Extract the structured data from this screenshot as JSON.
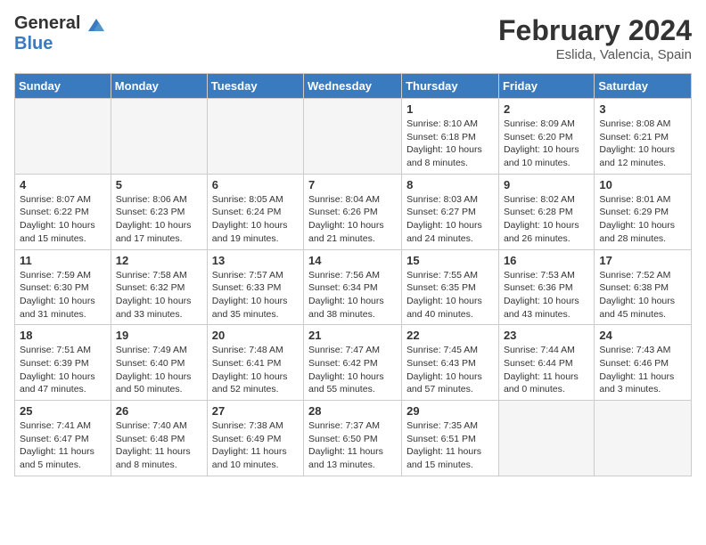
{
  "header": {
    "logo_general": "General",
    "logo_blue": "Blue",
    "title": "February 2024",
    "subtitle": "Eslida, Valencia, Spain"
  },
  "days_of_week": [
    "Sunday",
    "Monday",
    "Tuesday",
    "Wednesday",
    "Thursday",
    "Friday",
    "Saturday"
  ],
  "weeks": [
    [
      {
        "day": "",
        "info": ""
      },
      {
        "day": "",
        "info": ""
      },
      {
        "day": "",
        "info": ""
      },
      {
        "day": "",
        "info": ""
      },
      {
        "day": "1",
        "info": "Sunrise: 8:10 AM\nSunset: 6:18 PM\nDaylight: 10 hours and 8 minutes."
      },
      {
        "day": "2",
        "info": "Sunrise: 8:09 AM\nSunset: 6:20 PM\nDaylight: 10 hours and 10 minutes."
      },
      {
        "day": "3",
        "info": "Sunrise: 8:08 AM\nSunset: 6:21 PM\nDaylight: 10 hours and 12 minutes."
      }
    ],
    [
      {
        "day": "4",
        "info": "Sunrise: 8:07 AM\nSunset: 6:22 PM\nDaylight: 10 hours and 15 minutes."
      },
      {
        "day": "5",
        "info": "Sunrise: 8:06 AM\nSunset: 6:23 PM\nDaylight: 10 hours and 17 minutes."
      },
      {
        "day": "6",
        "info": "Sunrise: 8:05 AM\nSunset: 6:24 PM\nDaylight: 10 hours and 19 minutes."
      },
      {
        "day": "7",
        "info": "Sunrise: 8:04 AM\nSunset: 6:26 PM\nDaylight: 10 hours and 21 minutes."
      },
      {
        "day": "8",
        "info": "Sunrise: 8:03 AM\nSunset: 6:27 PM\nDaylight: 10 hours and 24 minutes."
      },
      {
        "day": "9",
        "info": "Sunrise: 8:02 AM\nSunset: 6:28 PM\nDaylight: 10 hours and 26 minutes."
      },
      {
        "day": "10",
        "info": "Sunrise: 8:01 AM\nSunset: 6:29 PM\nDaylight: 10 hours and 28 minutes."
      }
    ],
    [
      {
        "day": "11",
        "info": "Sunrise: 7:59 AM\nSunset: 6:30 PM\nDaylight: 10 hours and 31 minutes."
      },
      {
        "day": "12",
        "info": "Sunrise: 7:58 AM\nSunset: 6:32 PM\nDaylight: 10 hours and 33 minutes."
      },
      {
        "day": "13",
        "info": "Sunrise: 7:57 AM\nSunset: 6:33 PM\nDaylight: 10 hours and 35 minutes."
      },
      {
        "day": "14",
        "info": "Sunrise: 7:56 AM\nSunset: 6:34 PM\nDaylight: 10 hours and 38 minutes."
      },
      {
        "day": "15",
        "info": "Sunrise: 7:55 AM\nSunset: 6:35 PM\nDaylight: 10 hours and 40 minutes."
      },
      {
        "day": "16",
        "info": "Sunrise: 7:53 AM\nSunset: 6:36 PM\nDaylight: 10 hours and 43 minutes."
      },
      {
        "day": "17",
        "info": "Sunrise: 7:52 AM\nSunset: 6:38 PM\nDaylight: 10 hours and 45 minutes."
      }
    ],
    [
      {
        "day": "18",
        "info": "Sunrise: 7:51 AM\nSunset: 6:39 PM\nDaylight: 10 hours and 47 minutes."
      },
      {
        "day": "19",
        "info": "Sunrise: 7:49 AM\nSunset: 6:40 PM\nDaylight: 10 hours and 50 minutes."
      },
      {
        "day": "20",
        "info": "Sunrise: 7:48 AM\nSunset: 6:41 PM\nDaylight: 10 hours and 52 minutes."
      },
      {
        "day": "21",
        "info": "Sunrise: 7:47 AM\nSunset: 6:42 PM\nDaylight: 10 hours and 55 minutes."
      },
      {
        "day": "22",
        "info": "Sunrise: 7:45 AM\nSunset: 6:43 PM\nDaylight: 10 hours and 57 minutes."
      },
      {
        "day": "23",
        "info": "Sunrise: 7:44 AM\nSunset: 6:44 PM\nDaylight: 11 hours and 0 minutes."
      },
      {
        "day": "24",
        "info": "Sunrise: 7:43 AM\nSunset: 6:46 PM\nDaylight: 11 hours and 3 minutes."
      }
    ],
    [
      {
        "day": "25",
        "info": "Sunrise: 7:41 AM\nSunset: 6:47 PM\nDaylight: 11 hours and 5 minutes."
      },
      {
        "day": "26",
        "info": "Sunrise: 7:40 AM\nSunset: 6:48 PM\nDaylight: 11 hours and 8 minutes."
      },
      {
        "day": "27",
        "info": "Sunrise: 7:38 AM\nSunset: 6:49 PM\nDaylight: 11 hours and 10 minutes."
      },
      {
        "day": "28",
        "info": "Sunrise: 7:37 AM\nSunset: 6:50 PM\nDaylight: 11 hours and 13 minutes."
      },
      {
        "day": "29",
        "info": "Sunrise: 7:35 AM\nSunset: 6:51 PM\nDaylight: 11 hours and 15 minutes."
      },
      {
        "day": "",
        "info": ""
      },
      {
        "day": "",
        "info": ""
      }
    ]
  ]
}
